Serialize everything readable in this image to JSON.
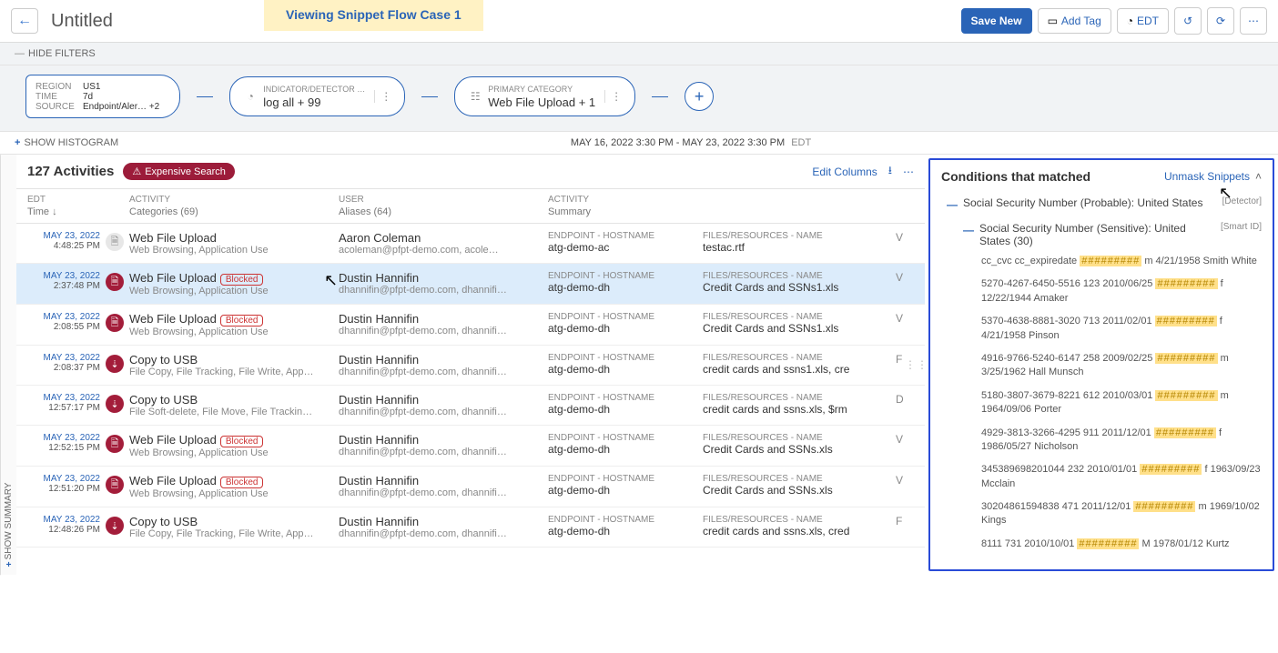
{
  "header": {
    "title": "Untitled",
    "banner": "Viewing Snippet Flow Case 1",
    "save": "Save New",
    "add_tag": "Add Tag",
    "tz": "EDT"
  },
  "filters": {
    "hide_label": "HIDE FILTERS",
    "main": {
      "region_k": "REGION",
      "region_v": "US1",
      "time_k": "TIME",
      "time_v": "7d",
      "source_k": "SOURCE",
      "source_v": "Endpoint/Aler… +2"
    },
    "p1": {
      "label": "INDICATOR/DETECTOR …",
      "value": "log all + 99"
    },
    "p2": {
      "label": "PRIMARY CATEGORY",
      "value": "Web File Upload + 1"
    }
  },
  "histogram": {
    "show": "SHOW HISTOGRAM",
    "range": "MAY 16, 2022 3:30 PM - MAY 23, 2022 3:30 PM",
    "tz": "EDT"
  },
  "summary_tab": "SHOW SUMMARY",
  "table": {
    "count": "127 Activities",
    "expensive": "Expensive Search",
    "edit_cols": "Edit Columns",
    "headers": {
      "time": "EDT",
      "time_sub": "Time ↓",
      "act": "ACTIVITY",
      "act_sub": "Categories (69)",
      "user": "USER",
      "user_sub": "Aliases (64)",
      "summ": "ACTIVITY",
      "summ_sub": "Summary"
    },
    "klabels": {
      "endpoint": "ENDPOINT - HOSTNAME",
      "files": "FILES/RESOURCES - NAME"
    },
    "blocked": "Blocked",
    "rows": [
      {
        "date": "MAY 23, 2022",
        "time": "4:48:25 PM",
        "icon": "doc",
        "iconbg": "#e7e7e7",
        "iconfg": "#888",
        "title": "Web File Upload",
        "cats": "Web Browsing, Application Use",
        "user": "Aaron Coleman",
        "alias": "acoleman@pfpt-demo.com, acole…",
        "host": "atg-demo-ac",
        "file": "testac.rtf",
        "blocked": false,
        "ext": "V",
        "selected": false
      },
      {
        "date": "MAY 23, 2022",
        "time": "2:37:48 PM",
        "icon": "doc",
        "iconbg": "#a31d3a",
        "iconfg": "#fff",
        "title": "Web File Upload",
        "cats": "Web Browsing, Application Use",
        "user": "Dustin Hannifin",
        "alias": "dhannifin@pfpt-demo.com, dhannifi…",
        "host": "atg-demo-dh",
        "file": "Credit Cards and SSNs1.xls",
        "blocked": true,
        "ext": "V",
        "selected": true
      },
      {
        "date": "MAY 23, 2022",
        "time": "2:08:55 PM",
        "icon": "doc",
        "iconbg": "#a31d3a",
        "iconfg": "#fff",
        "title": "Web File Upload",
        "cats": "Web Browsing, Application Use",
        "user": "Dustin Hannifin",
        "alias": "dhannifin@pfpt-demo.com, dhannifi…",
        "host": "atg-demo-dh",
        "file": "Credit Cards and SSNs1.xls",
        "blocked": true,
        "ext": "V",
        "selected": false
      },
      {
        "date": "MAY 23, 2022",
        "time": "2:08:37 PM",
        "icon": "usb",
        "iconbg": "#a31d3a",
        "iconfg": "#fff",
        "title": "Copy to USB",
        "cats": "File Copy, File Tracking, File Write, App…",
        "user": "Dustin Hannifin",
        "alias": "dhannifin@pfpt-demo.com, dhannifi…",
        "host": "atg-demo-dh",
        "file": "credit cards and ssns1.xls, cre",
        "blocked": false,
        "ext": "F",
        "selected": false
      },
      {
        "date": "MAY 23, 2022",
        "time": "12:57:17 PM",
        "icon": "usb",
        "iconbg": "#a31d3a",
        "iconfg": "#fff",
        "title": "Copy to USB",
        "cats": "File Soft-delete, File Move, File Trackin…",
        "user": "Dustin Hannifin",
        "alias": "dhannifin@pfpt-demo.com, dhannifi…",
        "host": "atg-demo-dh",
        "file": "credit cards and ssns.xls, $rm",
        "blocked": false,
        "ext": "D",
        "selected": false
      },
      {
        "date": "MAY 23, 2022",
        "time": "12:52:15 PM",
        "icon": "doc",
        "iconbg": "#a31d3a",
        "iconfg": "#fff",
        "title": "Web File Upload",
        "cats": "Web Browsing, Application Use",
        "user": "Dustin Hannifin",
        "alias": "dhannifin@pfpt-demo.com, dhannifi…",
        "host": "atg-demo-dh",
        "file": "Credit Cards and SSNs.xls",
        "blocked": true,
        "ext": "V",
        "selected": false
      },
      {
        "date": "MAY 23, 2022",
        "time": "12:51:20 PM",
        "icon": "doc",
        "iconbg": "#a31d3a",
        "iconfg": "#fff",
        "title": "Web File Upload",
        "cats": "Web Browsing, Application Use",
        "user": "Dustin Hannifin",
        "alias": "dhannifin@pfpt-demo.com, dhannifi…",
        "host": "atg-demo-dh",
        "file": "Credit Cards and SSNs.xls",
        "blocked": true,
        "ext": "V",
        "selected": false
      },
      {
        "date": "MAY 23, 2022",
        "time": "12:48:26 PM",
        "icon": "usb",
        "iconbg": "#a31d3a",
        "iconfg": "#fff",
        "title": "Copy to USB",
        "cats": "File Copy, File Tracking, File Write, App…",
        "user": "Dustin Hannifin",
        "alias": "dhannifin@pfpt-demo.com, dhannifi…",
        "host": "atg-demo-dh",
        "file": "credit cards and ssns.xls, cred",
        "blocked": false,
        "ext": "F",
        "selected": false
      }
    ]
  },
  "panel": {
    "title": "Conditions that matched",
    "unmask": "Unmask Snippets",
    "cond1": "Social Security Number (Probable): United States",
    "cond1_badge": "[Detector]",
    "cond2": "Social Security Number (Sensitive): United States (30)",
    "cond2_badge": "[Smart ID]",
    "mask": "#########",
    "snips": [
      {
        "pre": "cc_cvc cc_expiredate ",
        "post": " m 4/21/1958 Smith White"
      },
      {
        "pre": "5270-4267-6450-5516 123 2010/06/25 ",
        "post": " f 12/22/1944 Amaker"
      },
      {
        "pre": "5370-4638-8881-3020 713 2011/02/01 ",
        "post": " f 4/21/1958 Pinson"
      },
      {
        "pre": "4916-9766-5240-6147 258 2009/02/25 ",
        "post": " m 3/25/1962 Hall Munsch"
      },
      {
        "pre": "5180-3807-3679-8221 612 2010/03/01 ",
        "post": " m 1964/09/06 Porter"
      },
      {
        "pre": "4929-3813-3266-4295 911 2011/12/01 ",
        "post": " f 1986/05/27 Nicholson"
      },
      {
        "pre": "345389698201044 232 2010/01/01 ",
        "post": " f 1963/09/23 Mcclain"
      },
      {
        "pre": "30204861594838 471 2011/12/01 ",
        "post": " m 1969/10/02 Kings"
      },
      {
        "pre": "8111 731 2010/10/01 ",
        "post": " M 1978/01/12 Kurtz"
      }
    ]
  }
}
